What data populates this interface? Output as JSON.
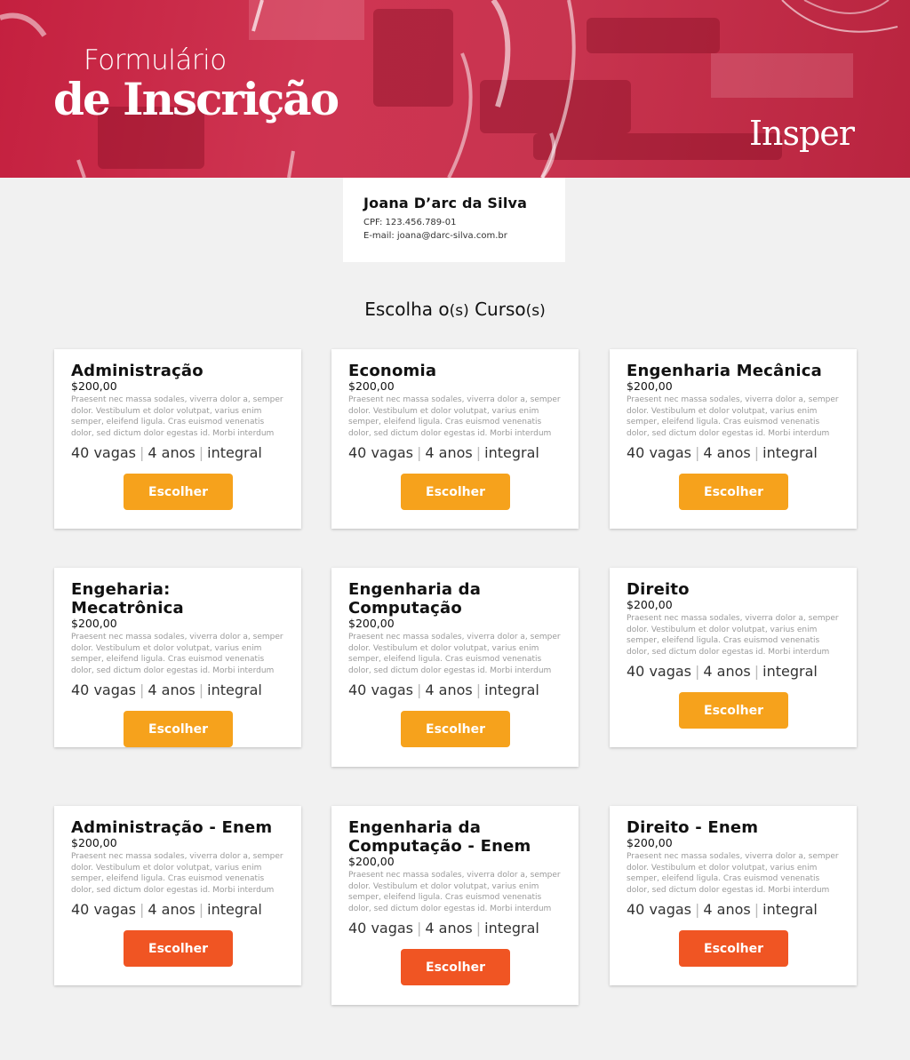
{
  "hero": {
    "title_line1": "Formulário",
    "title_line2": "de Inscrição",
    "brand": "Insper"
  },
  "profile": {
    "name": "Joana D’arc da Silva",
    "cpf": "CPF: 123.456.789-01",
    "email": "E-mail: joana@darc-silva.com.br"
  },
  "section": {
    "title_part1": "Escolha o",
    "title_s1": "(s)",
    "title_part2": " Curso",
    "title_s2": "(s)"
  },
  "colors": {
    "hero": "#c8344f",
    "button_primary": "#f6a21c",
    "button_enem": "#f05523"
  },
  "courses": [
    {
      "title": "Administração",
      "price": "$200,00",
      "desc": "Praesent nec massa sodales, viverra dolor a, semper dolor. Vestibulum et dolor volutpat, varius enim semper, eleifend ligula. Cras euismod venenatis dolor, sed dictum dolor egestas id. Morbi interdum",
      "vagas": "40 vagas",
      "anos": "4 anos",
      "periodo": "integral",
      "button": "Escolher"
    },
    {
      "title": "Economia",
      "price": "$200,00",
      "desc": "Praesent nec massa sodales, viverra dolor a, semper dolor. Vestibulum et dolor volutpat, varius enim semper, eleifend ligula. Cras euismod venenatis dolor, sed dictum dolor egestas id. Morbi interdum",
      "vagas": "40 vagas",
      "anos": "4 anos",
      "periodo": "integral",
      "button": "Escolher"
    },
    {
      "title": "Engenharia Mecânica",
      "price": "$200,00",
      "desc": "Praesent nec massa sodales, viverra dolor a, semper dolor. Vestibulum et dolor volutpat, varius enim semper, eleifend ligula. Cras euismod venenatis dolor, sed dictum dolor egestas id. Morbi interdum",
      "vagas": "40 vagas",
      "anos": "4 anos",
      "periodo": "integral",
      "button": "Escolher"
    },
    {
      "title": "Engeharia: Mecatrônica",
      "price": "$200,00",
      "desc": "Praesent nec massa sodales, viverra dolor a, semper dolor. Vestibulum et dolor volutpat, varius enim semper, eleifend ligula. Cras euismod venenatis dolor, sed dictum dolor egestas id. Morbi interdum",
      "vagas": "40 vagas",
      "anos": "4 anos",
      "periodo": "integral",
      "button": "Escolher"
    },
    {
      "title": "Engenharia da Computação",
      "price": "$200,00",
      "desc": "Praesent nec massa sodales, viverra dolor a, semper dolor. Vestibulum et dolor volutpat, varius enim semper, eleifend ligula. Cras euismod venenatis dolor, sed dictum dolor egestas id. Morbi interdum",
      "vagas": "40 vagas",
      "anos": "4 anos",
      "periodo": "integral",
      "button": "Escolher"
    },
    {
      "title": "Direito",
      "price": "$200,00",
      "desc": "Praesent nec massa sodales, viverra dolor a, semper dolor. Vestibulum et dolor volutpat, varius enim semper, eleifend ligula. Cras euismod venenatis dolor, sed dictum dolor egestas id. Morbi interdum",
      "vagas": "40 vagas",
      "anos": "4 anos",
      "periodo": "integral",
      "button": "Escolher"
    },
    {
      "title": "Administração - Enem",
      "price": "$200,00",
      "desc": "Praesent nec massa sodales, viverra dolor a, semper dolor. Vestibulum et dolor volutpat, varius enim semper, eleifend ligula. Cras euismod venenatis dolor, sed dictum dolor egestas id. Morbi interdum",
      "vagas": "40 vagas",
      "anos": "4 anos",
      "periodo": "integral",
      "button": "Escolher"
    },
    {
      "title": "Engenharia da Computação - Enem",
      "price": "$200,00",
      "desc": "Praesent nec massa sodales, viverra dolor a, semper dolor. Vestibulum et dolor volutpat, varius enim semper, eleifend ligula. Cras euismod venenatis dolor, sed dictum dolor egestas id. Morbi interdum",
      "vagas": "40 vagas",
      "anos": "4 anos",
      "periodo": "integral",
      "button": "Escolher"
    },
    {
      "title": "Direito - Enem",
      "price": "$200,00",
      "desc": "Praesent nec massa sodales, viverra dolor a, semper dolor. Vestibulum et dolor volutpat, varius enim semper, eleifend ligula. Cras euismod venenatis dolor, sed dictum dolor egestas id. Morbi interdum",
      "vagas": "40 vagas",
      "anos": "4 anos",
      "periodo": "integral",
      "button": "Escolher"
    }
  ]
}
